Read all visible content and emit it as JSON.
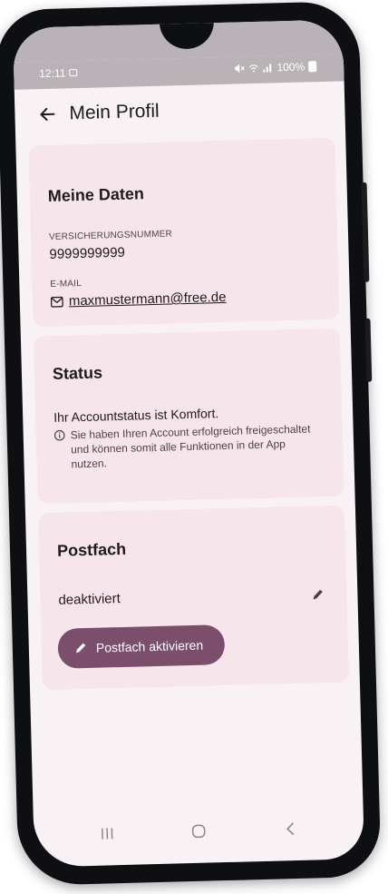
{
  "status_bar": {
    "time": "12:11",
    "battery": "100%"
  },
  "app_bar": {
    "title": "Mein Profil"
  },
  "meine_daten": {
    "title": "Meine Daten",
    "insurance_label": "VERSICHERUNGSNUMMER",
    "insurance_value": "9999999999",
    "email_label": "E-MAIL",
    "email_value": "maxmustermann@free.de"
  },
  "status": {
    "title": "Status",
    "account_status": "Ihr Accountstatus ist Komfort.",
    "info_text": "Sie haben Ihren Account erfolgreich freigeschaltet und können somit alle Funktionen in der App nutzen."
  },
  "postfach": {
    "title": "Postfach",
    "state": "deaktiviert",
    "activate_label": "Postfach aktivieren"
  },
  "colors": {
    "accent": "#7b4e6b",
    "card_background": "#f6e6eb",
    "screen_background": "#f8f2f4"
  },
  "icons": {
    "back": "arrow-left-icon",
    "email": "mail-icon",
    "info": "info-icon",
    "edit": "pencil-icon"
  }
}
